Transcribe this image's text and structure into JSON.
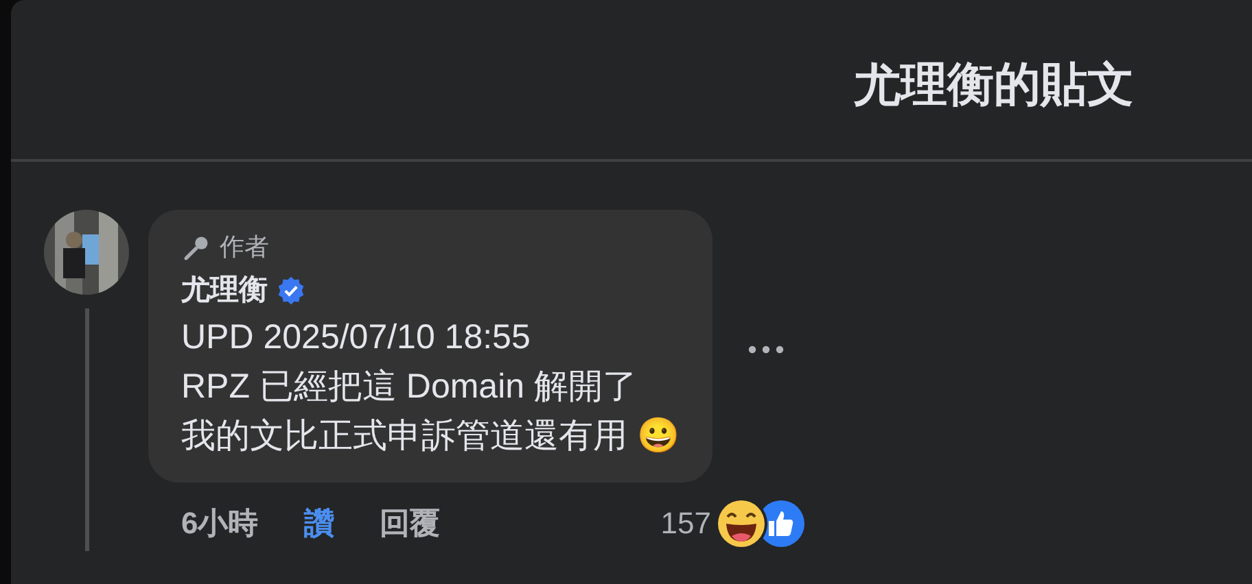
{
  "header": {
    "title": "尤理衡的貼文"
  },
  "comment": {
    "badge": "作者",
    "author": "尤理衡",
    "verified": true,
    "lines": [
      "UPD 2025/07/10 18:55",
      "RPZ 已經把這 Domain 解開了",
      "我的文比正式申訴管道還有用 😀"
    ],
    "time": "6小時",
    "like": {
      "label": "讚",
      "liked": true
    },
    "reply": "回覆",
    "reaction_count": "157"
  }
}
